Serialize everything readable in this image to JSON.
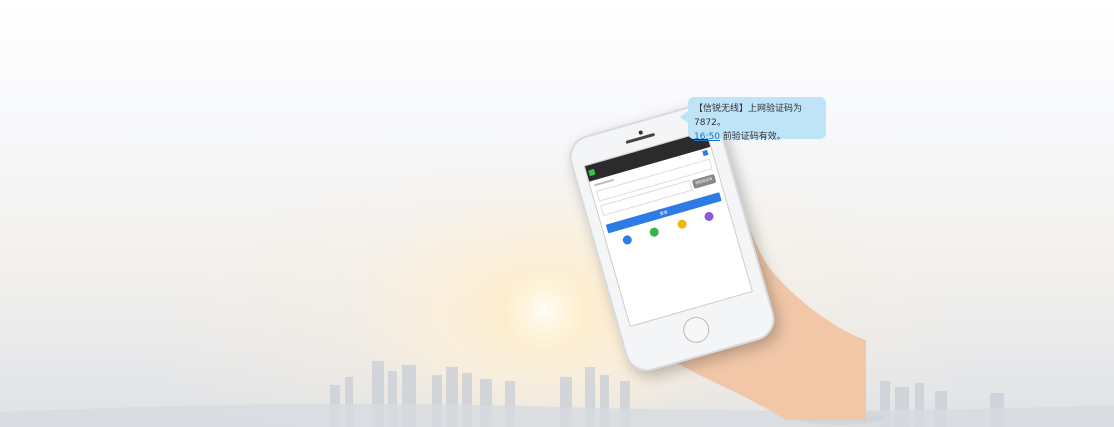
{
  "sms": {
    "prefix": "【信锐无线】上网验证码为7872。",
    "time": "16:50",
    "suffix": " 前验证码有效。"
  },
  "phone_screen": {
    "login_button": "登录",
    "get_code_button": "获取验证码"
  },
  "colors": {
    "bubble": "#bfe3f7",
    "link": "#1a73c9",
    "primary": "#2d7be5"
  }
}
